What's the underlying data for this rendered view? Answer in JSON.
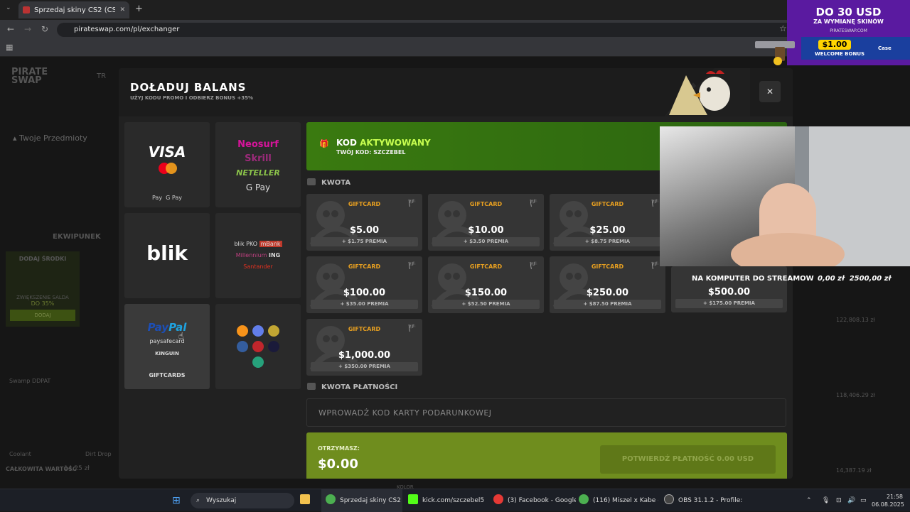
{
  "browser": {
    "tab_title": "Sprzedaj skiny CS2 (CS:GO) | N",
    "url": "pirateswap.com/pl/exchanger"
  },
  "site": {
    "logo_line1": "PIRATE",
    "logo_line2": "SWAP",
    "nav_item": "TR",
    "items_header": "Twoje Przedmioty",
    "inventory_tab": "EKWIPUNEK",
    "add_funds": "DODAJ ŚRODKI",
    "increase_balance": "ZWIĘKSZENIE SALDA",
    "increase_pct": "DO 35%",
    "add_button": "DODAJ",
    "total_label": "CAŁKOWITA WARTOŚĆ",
    "total_value": "14,25 zł",
    "item1": "Swamp DDPAT",
    "item2": "Coolant",
    "item3": "Dirt Drop",
    "price1": "122,808.13 zł",
    "price2": "118,406.29 zł",
    "price3": "14,387.19 zł"
  },
  "modal": {
    "title": "DOŁADUJ BALANS",
    "subtitle": "UŻYJ KODU PROMO I ODBIERZ BONUS +35%",
    "close": "✕",
    "payments": {
      "visa": "VISA",
      "wallet1": "Pay",
      "wallet2": "G Pay",
      "neosurf": "Neosurf",
      "skrill": "Skrill",
      "neteller": "NETELLER",
      "gpay": "G Pay",
      "blik": "blik",
      "bank1": "blik",
      "bank2": "PKO",
      "bank3": "mBank",
      "bank4": "Millennium",
      "bank5": "ING",
      "bank6": "Santander",
      "paypal1": "Pay",
      "paypal2": "Pal",
      "paysafe": "paysafecard",
      "kinguin": "KINGUIN",
      "giftcards": "GIFTCARDS"
    },
    "code": {
      "title_white": "KOD",
      "title_green": "AKTYWOWANY",
      "your_code": "TWÓJ KOD: SZCZEBEL"
    },
    "amount_label": "KWOTA",
    "cards": [
      {
        "label": "GIFTCARD",
        "amount": "$5.00",
        "bonus": "+ $1.75 PREMIA"
      },
      {
        "label": "GIFTCARD",
        "amount": "$10.00",
        "bonus": "+ $3.50 PREMIA"
      },
      {
        "label": "GIFTCARD",
        "amount": "$25.00",
        "bonus": "+ $8.75 PREMIA"
      },
      {
        "label": "GIFTCARD",
        "amount": "$100.00",
        "bonus": "+ $35.00 PREMIA"
      },
      {
        "label": "GIFTCARD",
        "amount": "$150.00",
        "bonus": "+ $52.50 PREMIA"
      },
      {
        "label": "GIFTCARD",
        "amount": "$250.00",
        "bonus": "+ $87.50 PREMIA"
      },
      {
        "label": "GIFTCARD",
        "amount": "$500.00",
        "bonus": "+ $175.00 PREMIA"
      },
      {
        "label": "GIFTCARD",
        "amount": "$1,000.00",
        "bonus": "+ $350.00 PREMIA"
      }
    ],
    "payment_amount_label": "KWOTA PŁATNOŚCI",
    "gift_placeholder": "WPROWADŹ KOD KARTY PODARUNKOWEJ",
    "receive_label": "OTRZYMASZ:",
    "receive_value": "$0.00",
    "confirm_label": "POTWIERDŹ PŁATNOŚĆ 0.00 USD"
  },
  "overlay": {
    "promo_line1": "DO 30 USD",
    "promo_line2": "ZA WYMIANĘ SKINÓW",
    "promo_site": "PIRATESWAP.COM",
    "bonus_amount": "$1.00",
    "bonus_label": "WELCOME BONUS",
    "bonus_brand": "Case",
    "goal_text": "NA KOMPUTER DO STREAMOW",
    "goal_progress": "0,00 zł",
    "goal_target": "2500,00 zł",
    "bottom_label": "KOLOR"
  },
  "taskbar": {
    "search": "Wyszukaj",
    "app1": "Sprzedaj skiny CS2 (CS:G",
    "app2": "kick.com/szczebel5",
    "app3": "(3) Facebook - Google C",
    "app4": "(116) Miszel x Kabe - RA",
    "app5": "OBS 31.1.2 - Profile: Bez",
    "time": "21:58",
    "date": "06.08.2025"
  },
  "colors": {
    "accent_green": "#6f8d1e",
    "code_green": "#3a7a10",
    "gift_orange": "#e8a020",
    "modal_bg": "#212121"
  }
}
